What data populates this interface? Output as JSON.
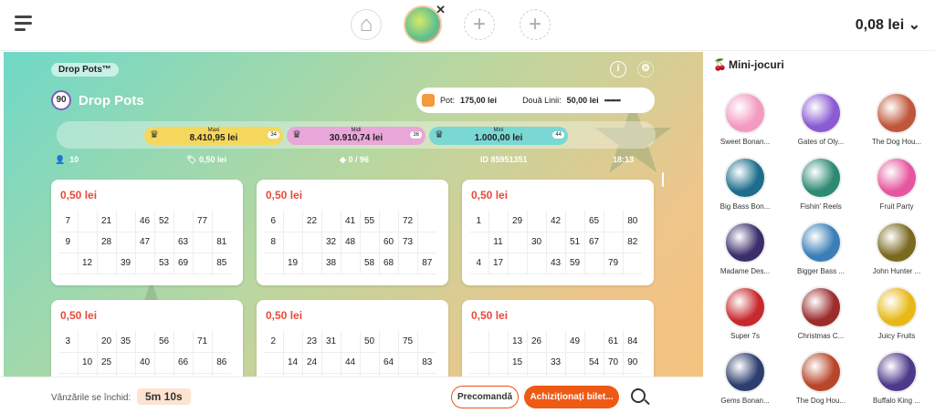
{
  "header": {
    "balance": "0,08 lei"
  },
  "game": {
    "brand_badge": "Drop Pots™",
    "title": "Drop Pots",
    "ball_number": "90",
    "pot_label": "Pot:",
    "pot_value": "175,00 lei",
    "lines_label": "Două Linii:",
    "lines_value": "50,00 lei",
    "jackpots": [
      {
        "name": "Maxi",
        "value": "8.410,95 lei",
        "count": "34"
      },
      {
        "name": "Midi",
        "value": "30.910,74 lei",
        "count": "36"
      },
      {
        "name": "Mini",
        "value": "1.000,00 lei",
        "count": "44"
      }
    ],
    "players": "10",
    "ticket_price": "0,50 lei",
    "tickets": "0 / 96",
    "id": "ID  85951351",
    "time": "18:13",
    "cards": [
      {
        "price": "0,50 lei",
        "rows": [
          [
            "7",
            "",
            "21",
            "",
            "46",
            "52",
            "",
            "77",
            ""
          ],
          [
            "9",
            "",
            "28",
            "",
            "47",
            "",
            "63",
            "",
            "81"
          ],
          [
            "",
            "12",
            "",
            "39",
            "",
            "53",
            "69",
            "",
            "85"
          ]
        ]
      },
      {
        "price": "0,50 lei",
        "rows": [
          [
            "6",
            "",
            "22",
            "",
            "41",
            "55",
            "",
            "72",
            ""
          ],
          [
            "8",
            "",
            "",
            "32",
            "48",
            "",
            "60",
            "73",
            ""
          ],
          [
            "",
            "19",
            "",
            "38",
            "",
            "58",
            "68",
            "",
            "87"
          ]
        ]
      },
      {
        "price": "0,50 lei",
        "rows": [
          [
            "1",
            "",
            "29",
            "",
            "42",
            "",
            "65",
            "",
            "80"
          ],
          [
            "",
            "11",
            "",
            "30",
            "",
            "51",
            "67",
            "",
            "82"
          ],
          [
            "4",
            "17",
            "",
            "",
            "43",
            "59",
            "",
            "79",
            ""
          ]
        ]
      },
      {
        "price": "0,50 lei",
        "rows": [
          [
            "3",
            "",
            "20",
            "35",
            "",
            "56",
            "",
            "71",
            ""
          ],
          [
            "",
            "10",
            "25",
            "",
            "40",
            "",
            "66",
            "",
            "86"
          ],
          [
            "",
            "",
            "",
            "",
            "",
            "",
            "",
            "",
            ""
          ]
        ]
      },
      {
        "price": "0,50 lei",
        "rows": [
          [
            "2",
            "",
            "23",
            "31",
            "",
            "50",
            "",
            "75",
            ""
          ],
          [
            "",
            "14",
            "24",
            "",
            "44",
            "",
            "64",
            "",
            "83"
          ],
          [
            "",
            "",
            "",
            "",
            "",
            "",
            "",
            "",
            ""
          ]
        ]
      },
      {
        "price": "0,50 lei",
        "rows": [
          [
            "",
            "",
            "13",
            "26",
            "",
            "49",
            "",
            "61",
            "84"
          ],
          [
            "",
            "",
            "15",
            "",
            "33",
            "",
            "54",
            "70",
            "90"
          ],
          [
            "",
            "",
            "",
            "",
            "",
            "",
            "",
            "",
            ""
          ]
        ]
      }
    ]
  },
  "bottom": {
    "sales_label": "Vânzările se închid:",
    "timer": "5m 10s",
    "preorder": "Precomandă",
    "buy": "Achiziționați bilet..."
  },
  "sidebar": {
    "title": "Mini-jocuri",
    "games": [
      {
        "label": "Sweet Bonan...",
        "color": "#f49ac1"
      },
      {
        "label": "Gates of Oly...",
        "color": "#8a5bd3"
      },
      {
        "label": "The Dog Hou...",
        "color": "#c0573a"
      },
      {
        "label": "Big Bass Bon...",
        "color": "#1d6e8c"
      },
      {
        "label": "Fishin' Reels",
        "color": "#2e8a74"
      },
      {
        "label": "Fruit Party",
        "color": "#e6569f"
      },
      {
        "label": "Madame Des...",
        "color": "#3b2e6b"
      },
      {
        "label": "Bigger Bass ...",
        "color": "#3a7fb8"
      },
      {
        "label": "John Hunter ...",
        "color": "#7a6a20"
      },
      {
        "label": "Super 7s",
        "color": "#c8292e"
      },
      {
        "label": "Christmas C...",
        "color": "#9b2d2d"
      },
      {
        "label": "Juicy Fruits",
        "color": "#e8b817"
      },
      {
        "label": "Gems Bonan...",
        "color": "#2c3e6e"
      },
      {
        "label": "The Dog Hou...",
        "color": "#b8462b"
      },
      {
        "label": "Buffalo King ...",
        "color": "#4d3a8a"
      }
    ]
  }
}
